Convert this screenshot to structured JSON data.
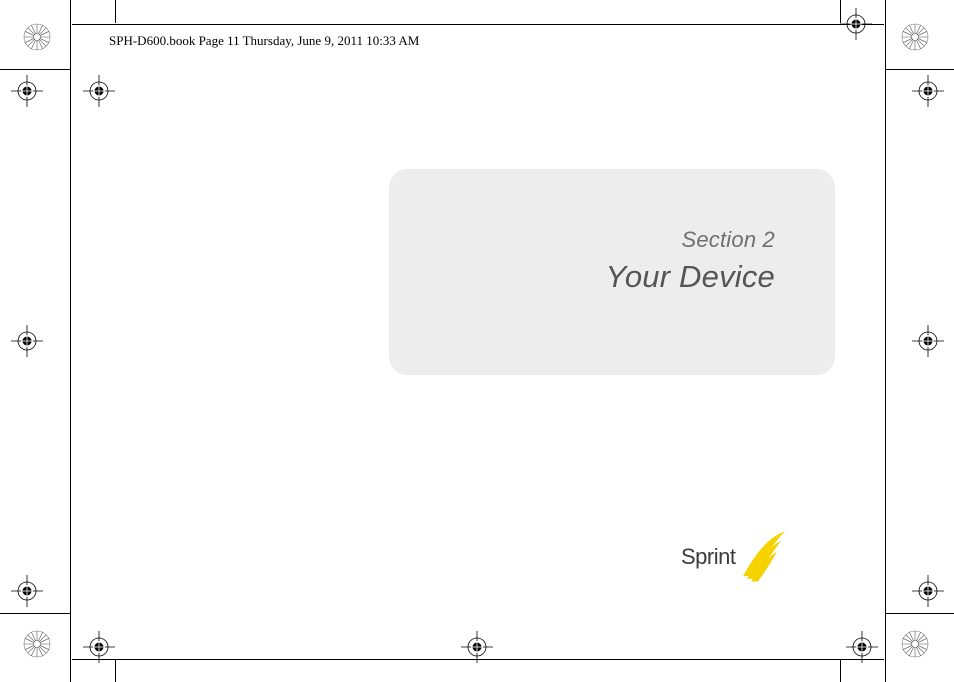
{
  "header": {
    "meta_line": "SPH-D600.book  Page 11  Thursday, June 9, 2011  10:33 AM"
  },
  "title_card": {
    "section_label": "Section 2",
    "section_title": "Your Device"
  },
  "logo": {
    "brand": "Sprint"
  },
  "colors": {
    "card_bg": "#ededed",
    "text_gray": "#6f6f6f",
    "title_gray": "#555555",
    "sprint_yellow": "#f5d200"
  }
}
